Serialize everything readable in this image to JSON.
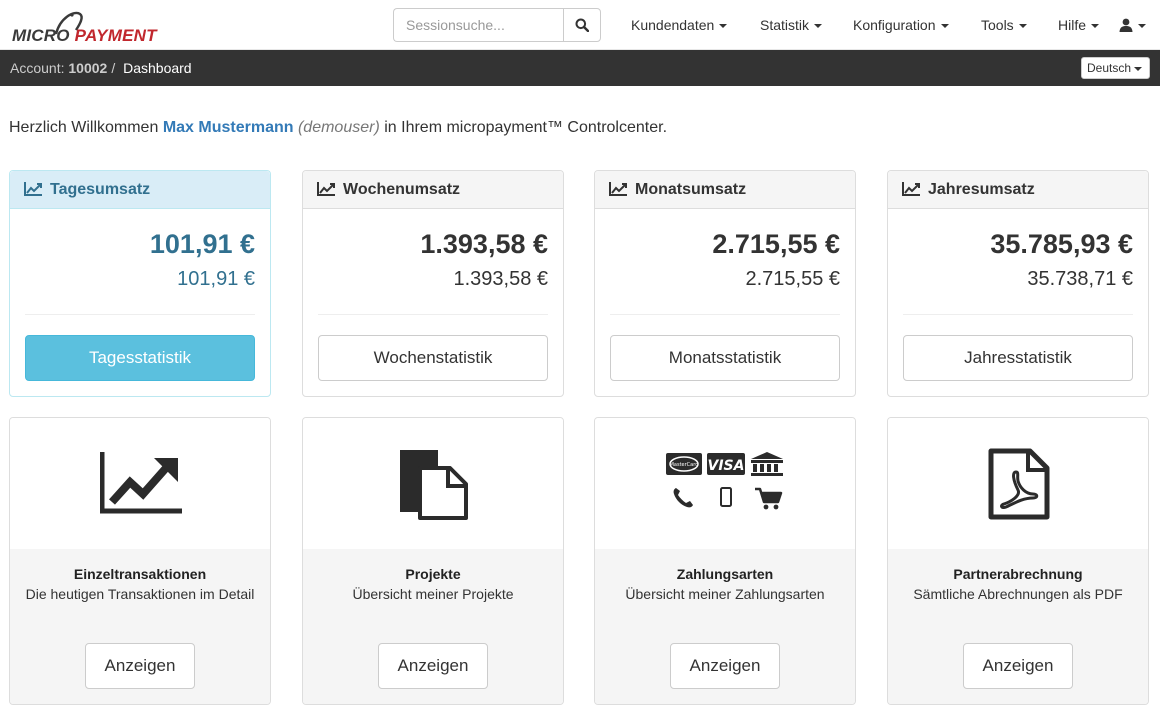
{
  "logo": {
    "word1": "MICRO",
    "word2": "PAYMENT"
  },
  "search": {
    "placeholder": "Sessionsuche..."
  },
  "nav": {
    "items": [
      {
        "label": "Kundendaten"
      },
      {
        "label": "Statistik"
      },
      {
        "label": "Konfiguration"
      },
      {
        "label": "Tools"
      },
      {
        "label": "Hilfe"
      }
    ]
  },
  "breadcrumb": {
    "account_label": "Account:",
    "account_number": "10002",
    "separator": "/",
    "current": "Dashboard"
  },
  "language": {
    "selected": "Deutsch"
  },
  "welcome": {
    "prefix": "Herzlich Willkommen",
    "name": "Max Mustermann",
    "username": "(demouser)",
    "suffix": "in Ihrem micropayment™ Controlcenter."
  },
  "revenue": [
    {
      "title": "Tagesumsatz",
      "primary": "101,91 €",
      "secondary": "101,91 €",
      "button": "Tagesstatistik"
    },
    {
      "title": "Wochenumsatz",
      "primary": "1.393,58 €",
      "secondary": "1.393,58 €",
      "button": "Wochenstatistik"
    },
    {
      "title": "Monatsumsatz",
      "primary": "2.715,55 €",
      "secondary": "2.715,55 €",
      "button": "Monatsstatistik"
    },
    {
      "title": "Jahresumsatz",
      "primary": "35.785,93 €",
      "secondary": "35.738,71 €",
      "button": "Jahresstatistik"
    }
  ],
  "tiles": [
    {
      "icon": "line-chart-icon",
      "title": "Einzeltransaktionen",
      "desc": "Die heutigen Transaktionen im Detail",
      "button": "Anzeigen"
    },
    {
      "icon": "documents-icon",
      "title": "Projekte",
      "desc": "Übersicht meiner Projekte",
      "button": "Anzeigen"
    },
    {
      "icon": "payment-methods-icon",
      "title": "Zahlungsarten",
      "desc": "Übersicht meiner Zahlungsarten",
      "button": "Anzeigen",
      "card_labels": {
        "mastercard": "MasterCard",
        "visa": "VISA"
      }
    },
    {
      "icon": "pdf-file-icon",
      "title": "Partnerabrechnung",
      "desc": "Sämtliche Abrechnungen als PDF",
      "button": "Anzeigen"
    }
  ],
  "colors": {
    "accent": "#337ab7",
    "info_bg": "#d9edf7",
    "info_text": "#31708f",
    "info_button": "#5bc0de",
    "brand_red": "#c1272d",
    "dark_bar": "#333333"
  }
}
